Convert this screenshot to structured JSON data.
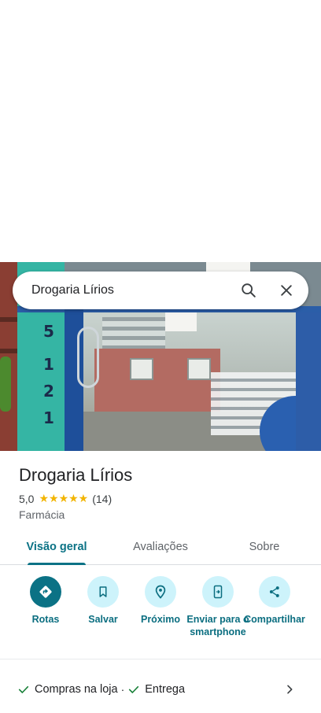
{
  "search": {
    "query": "Drogaria Lírios"
  },
  "place": {
    "name": "Drogaria Lírios",
    "rating": "5,0",
    "stars": "★★★★★",
    "reviews_count": "(14)",
    "category": "Farmácia"
  },
  "tabs": [
    {
      "label": "Visão geral",
      "active": true
    },
    {
      "label": "Avaliações",
      "active": false
    },
    {
      "label": "Sobre",
      "active": false
    }
  ],
  "actions": [
    {
      "label": "Rotas",
      "icon": "directions-icon"
    },
    {
      "label": "Salvar",
      "icon": "bookmark-icon"
    },
    {
      "label": "Próximo",
      "icon": "nearby-icon"
    },
    {
      "label": "Enviar para o smartphone",
      "icon": "send-to-phone-icon"
    },
    {
      "label": "Compartilhar",
      "icon": "share-icon"
    }
  ],
  "features": {
    "items": [
      "Compras na loja",
      "Entrega"
    ],
    "separator": "·"
  },
  "colors": {
    "accent": "#0b7285",
    "action_bg": "#cdf3fb",
    "star": "#f2b400",
    "check": "#188038"
  }
}
